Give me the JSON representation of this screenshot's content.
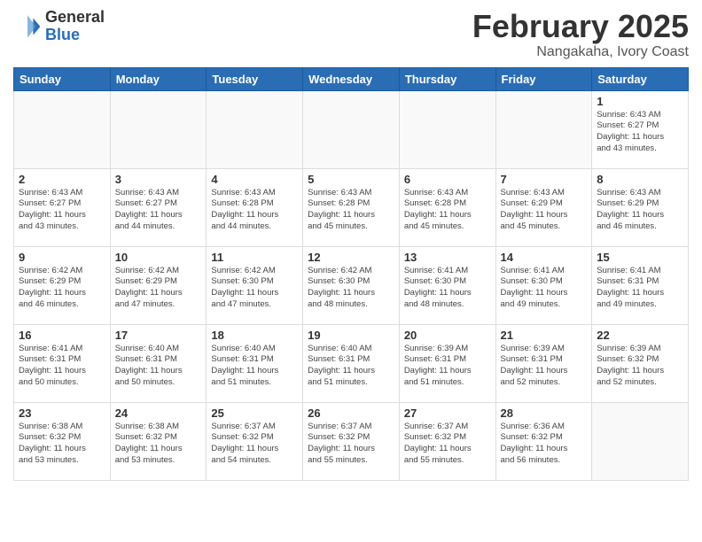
{
  "logo": {
    "general": "General",
    "blue": "Blue"
  },
  "title": "February 2025",
  "location": "Nangakaha, Ivory Coast",
  "days_of_week": [
    "Sunday",
    "Monday",
    "Tuesday",
    "Wednesday",
    "Thursday",
    "Friday",
    "Saturday"
  ],
  "weeks": [
    [
      {
        "day": "",
        "info": ""
      },
      {
        "day": "",
        "info": ""
      },
      {
        "day": "",
        "info": ""
      },
      {
        "day": "",
        "info": ""
      },
      {
        "day": "",
        "info": ""
      },
      {
        "day": "",
        "info": ""
      },
      {
        "day": "1",
        "info": "Sunrise: 6:43 AM\nSunset: 6:27 PM\nDaylight: 11 hours\nand 43 minutes."
      }
    ],
    [
      {
        "day": "2",
        "info": "Sunrise: 6:43 AM\nSunset: 6:27 PM\nDaylight: 11 hours\nand 43 minutes."
      },
      {
        "day": "3",
        "info": "Sunrise: 6:43 AM\nSunset: 6:27 PM\nDaylight: 11 hours\nand 44 minutes."
      },
      {
        "day": "4",
        "info": "Sunrise: 6:43 AM\nSunset: 6:28 PM\nDaylight: 11 hours\nand 44 minutes."
      },
      {
        "day": "5",
        "info": "Sunrise: 6:43 AM\nSunset: 6:28 PM\nDaylight: 11 hours\nand 45 minutes."
      },
      {
        "day": "6",
        "info": "Sunrise: 6:43 AM\nSunset: 6:28 PM\nDaylight: 11 hours\nand 45 minutes."
      },
      {
        "day": "7",
        "info": "Sunrise: 6:43 AM\nSunset: 6:29 PM\nDaylight: 11 hours\nand 45 minutes."
      },
      {
        "day": "8",
        "info": "Sunrise: 6:43 AM\nSunset: 6:29 PM\nDaylight: 11 hours\nand 46 minutes."
      }
    ],
    [
      {
        "day": "9",
        "info": "Sunrise: 6:42 AM\nSunset: 6:29 PM\nDaylight: 11 hours\nand 46 minutes."
      },
      {
        "day": "10",
        "info": "Sunrise: 6:42 AM\nSunset: 6:29 PM\nDaylight: 11 hours\nand 47 minutes."
      },
      {
        "day": "11",
        "info": "Sunrise: 6:42 AM\nSunset: 6:30 PM\nDaylight: 11 hours\nand 47 minutes."
      },
      {
        "day": "12",
        "info": "Sunrise: 6:42 AM\nSunset: 6:30 PM\nDaylight: 11 hours\nand 48 minutes."
      },
      {
        "day": "13",
        "info": "Sunrise: 6:41 AM\nSunset: 6:30 PM\nDaylight: 11 hours\nand 48 minutes."
      },
      {
        "day": "14",
        "info": "Sunrise: 6:41 AM\nSunset: 6:30 PM\nDaylight: 11 hours\nand 49 minutes."
      },
      {
        "day": "15",
        "info": "Sunrise: 6:41 AM\nSunset: 6:31 PM\nDaylight: 11 hours\nand 49 minutes."
      }
    ],
    [
      {
        "day": "16",
        "info": "Sunrise: 6:41 AM\nSunset: 6:31 PM\nDaylight: 11 hours\nand 50 minutes."
      },
      {
        "day": "17",
        "info": "Sunrise: 6:40 AM\nSunset: 6:31 PM\nDaylight: 11 hours\nand 50 minutes."
      },
      {
        "day": "18",
        "info": "Sunrise: 6:40 AM\nSunset: 6:31 PM\nDaylight: 11 hours\nand 51 minutes."
      },
      {
        "day": "19",
        "info": "Sunrise: 6:40 AM\nSunset: 6:31 PM\nDaylight: 11 hours\nand 51 minutes."
      },
      {
        "day": "20",
        "info": "Sunrise: 6:39 AM\nSunset: 6:31 PM\nDaylight: 11 hours\nand 51 minutes."
      },
      {
        "day": "21",
        "info": "Sunrise: 6:39 AM\nSunset: 6:31 PM\nDaylight: 11 hours\nand 52 minutes."
      },
      {
        "day": "22",
        "info": "Sunrise: 6:39 AM\nSunset: 6:32 PM\nDaylight: 11 hours\nand 52 minutes."
      }
    ],
    [
      {
        "day": "23",
        "info": "Sunrise: 6:38 AM\nSunset: 6:32 PM\nDaylight: 11 hours\nand 53 minutes."
      },
      {
        "day": "24",
        "info": "Sunrise: 6:38 AM\nSunset: 6:32 PM\nDaylight: 11 hours\nand 53 minutes."
      },
      {
        "day": "25",
        "info": "Sunrise: 6:37 AM\nSunset: 6:32 PM\nDaylight: 11 hours\nand 54 minutes."
      },
      {
        "day": "26",
        "info": "Sunrise: 6:37 AM\nSunset: 6:32 PM\nDaylight: 11 hours\nand 55 minutes."
      },
      {
        "day": "27",
        "info": "Sunrise: 6:37 AM\nSunset: 6:32 PM\nDaylight: 11 hours\nand 55 minutes."
      },
      {
        "day": "28",
        "info": "Sunrise: 6:36 AM\nSunset: 6:32 PM\nDaylight: 11 hours\nand 56 minutes."
      },
      {
        "day": "",
        "info": ""
      }
    ]
  ]
}
